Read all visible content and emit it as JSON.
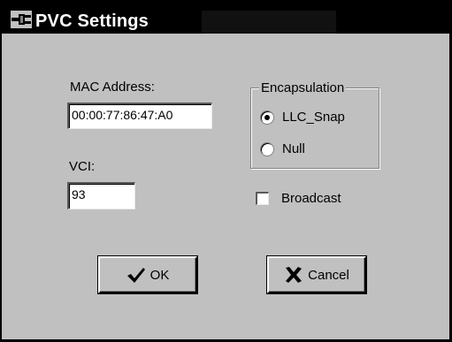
{
  "window": {
    "title": "PVC Settings",
    "icon": "connector-icon"
  },
  "mac_address": {
    "label": "MAC Address:",
    "value": "00:00:77:86:47:A0"
  },
  "vci": {
    "label": "VCI:",
    "value": "93"
  },
  "encapsulation": {
    "legend": "Encapsulation",
    "options": [
      {
        "label": "LLC_Snap",
        "selected": true
      },
      {
        "label": "Null",
        "selected": false
      }
    ]
  },
  "broadcast": {
    "label": "Broadcast",
    "checked": false
  },
  "buttons": {
    "ok": {
      "label": "OK",
      "icon": "checkmark-icon"
    },
    "cancel": {
      "label": "Cancel",
      "icon": "cross-icon"
    }
  }
}
